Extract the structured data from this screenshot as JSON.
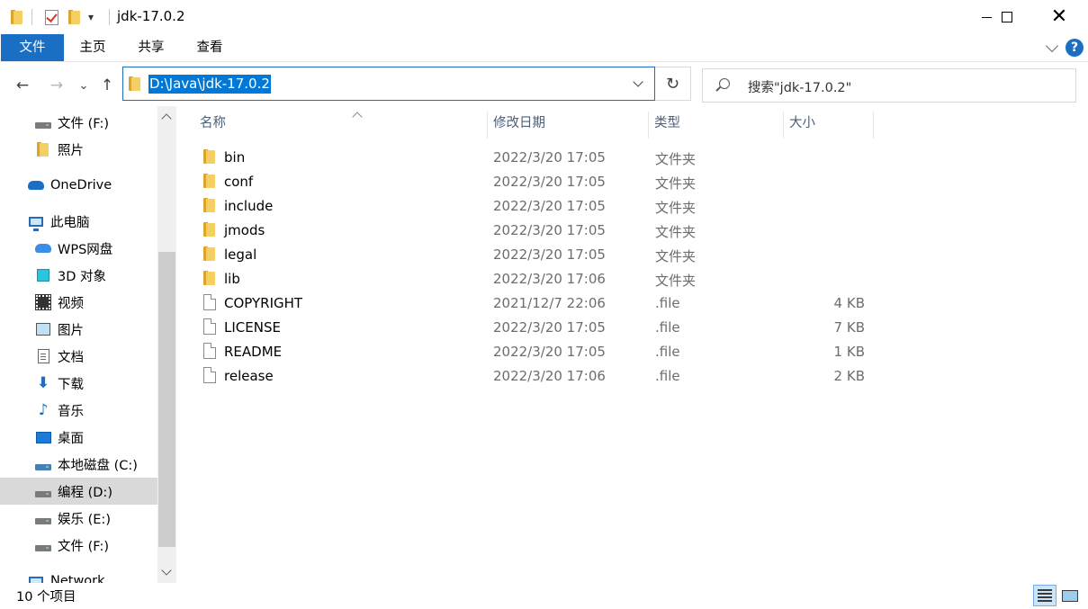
{
  "window": {
    "title": "jdk-17.0.2",
    "minimize_icon": "minimize-icon",
    "maximize_icon": "maximize-icon",
    "close_glyph": "✕"
  },
  "quick_access": {
    "dropdown_glyph": "▾"
  },
  "ribbon": {
    "tabs": [
      "文件",
      "主页",
      "共享",
      "查看"
    ],
    "help_glyph": "?",
    "accent_color": "#1a6fc4"
  },
  "nav": {
    "back_glyph": "←",
    "forward_glyph": "→",
    "recent_glyph": "⌄",
    "up_glyph": "↑",
    "address": "D:\\Java\\jdk-17.0.2",
    "refresh_glyph": "↻",
    "search_placeholder": "搜索\"jdk-17.0.2\""
  },
  "sidebar": {
    "items": [
      {
        "label": "文件 (F:)",
        "icon": "drive-icon"
      },
      {
        "label": "照片",
        "icon": "folder-icon"
      },
      {
        "label": "OneDrive",
        "icon": "cloud-icon"
      },
      {
        "label": "此电脑",
        "icon": "computer-icon"
      },
      {
        "label": "WPS网盘",
        "icon": "wps-cloud-icon"
      },
      {
        "label": "3D 对象",
        "icon": "3d-objects-icon"
      },
      {
        "label": "视频",
        "icon": "video-icon"
      },
      {
        "label": "图片",
        "icon": "picture-icon"
      },
      {
        "label": "文档",
        "icon": "document-icon"
      },
      {
        "label": "下载",
        "icon": "download-icon",
        "glyph": "⬇"
      },
      {
        "label": "音乐",
        "icon": "music-icon",
        "glyph": "♪"
      },
      {
        "label": "桌面",
        "icon": "desktop-icon"
      },
      {
        "label": "本地磁盘 (C:)",
        "icon": "windows-drive-icon"
      },
      {
        "label": "编程 (D:)",
        "icon": "drive-icon",
        "selected": true
      },
      {
        "label": "娱乐 (E:)",
        "icon": "drive-icon"
      },
      {
        "label": "文件 (F:)",
        "icon": "drive-icon"
      },
      {
        "label": "Network",
        "icon": "network-icon"
      }
    ]
  },
  "columns": [
    "名称",
    "修改日期",
    "类型",
    "大小"
  ],
  "files": [
    {
      "name": "bin",
      "date": "2022/3/20 17:05",
      "type": "文件夹",
      "size": "",
      "kind": "folder"
    },
    {
      "name": "conf",
      "date": "2022/3/20 17:05",
      "type": "文件夹",
      "size": "",
      "kind": "folder"
    },
    {
      "name": "include",
      "date": "2022/3/20 17:05",
      "type": "文件夹",
      "size": "",
      "kind": "folder"
    },
    {
      "name": "jmods",
      "date": "2022/3/20 17:05",
      "type": "文件夹",
      "size": "",
      "kind": "folder"
    },
    {
      "name": "legal",
      "date": "2022/3/20 17:05",
      "type": "文件夹",
      "size": "",
      "kind": "folder"
    },
    {
      "name": "lib",
      "date": "2022/3/20 17:06",
      "type": "文件夹",
      "size": "",
      "kind": "folder"
    },
    {
      "name": "COPYRIGHT",
      "date": "2021/12/7 22:06",
      "type": ".file",
      "size": "4 KB",
      "kind": "file"
    },
    {
      "name": "LICENSE",
      "date": "2022/3/20 17:05",
      "type": ".file",
      "size": "7 KB",
      "kind": "file"
    },
    {
      "name": "README",
      "date": "2022/3/20 17:05",
      "type": ".file",
      "size": "1 KB",
      "kind": "file"
    },
    {
      "name": "release",
      "date": "2022/3/20 17:06",
      "type": ".file",
      "size": "2 KB",
      "kind": "file"
    }
  ],
  "status": {
    "item_count": "10 个项目"
  }
}
